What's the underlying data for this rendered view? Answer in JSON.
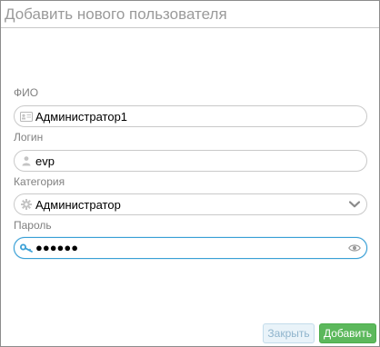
{
  "dialog": {
    "title": "Добавить нового пользователя"
  },
  "fields": {
    "fio": {
      "label": "ФИО",
      "value": "Администратор1",
      "icon": "id-card-icon"
    },
    "login": {
      "label": "Логин",
      "value": "evp",
      "icon": "user-icon"
    },
    "category": {
      "label": "Категория",
      "value": "Администратор",
      "icon": "gear-icon",
      "right_icon": "chevron-down-icon"
    },
    "password": {
      "label": "Пароль",
      "value": "●●●●●●",
      "icon": "key-icon",
      "right_icon": "eye-icon",
      "focused": true
    }
  },
  "buttons": {
    "close_label": "Закрыть",
    "add_label": "Добавить"
  },
  "colors": {
    "accent": "#3aa0d6",
    "primary_button": "#5cb85c",
    "secondary_button_bg": "#e9f3f9"
  }
}
